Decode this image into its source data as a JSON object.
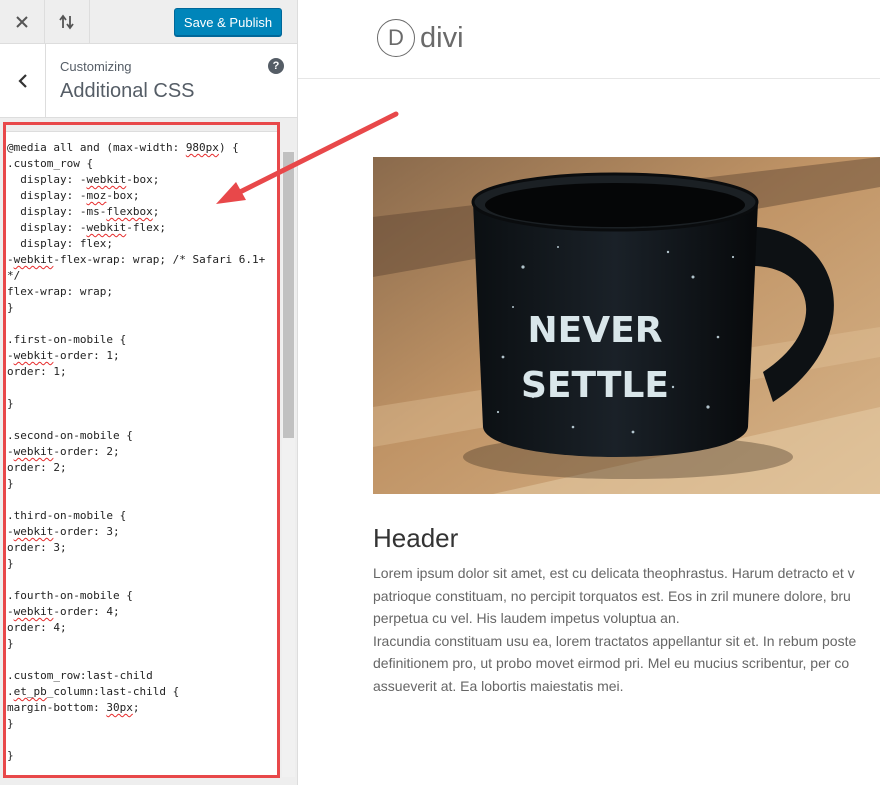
{
  "topbar": {
    "close_icon": "close-x-icon",
    "preview_toggle_icon": "up-down-arrows-icon",
    "publish_label": "Save & Publish"
  },
  "section": {
    "back_icon": "chevron-left-icon",
    "customizing_label": "Customizing",
    "title": "Additional CSS",
    "help_icon_glyph": "?"
  },
  "css_editor": {
    "lines": [
      "@media all and (max-width: 980px) {",
      ".custom_row {",
      "  display: -webkit-box;",
      "  display: -moz-box;",
      "  display: -ms-flexbox;",
      "  display: -webkit-flex;",
      "  display: flex;",
      "-webkit-flex-wrap: wrap; /* Safari 6.1+",
      "*/",
      "flex-wrap: wrap;",
      "}",
      "",
      ".first-on-mobile {",
      "-webkit-order: 1;",
      "order: 1;",
      "",
      "}",
      "",
      ".second-on-mobile {",
      "-webkit-order: 2;",
      "order: 2;",
      "}",
      "",
      ".third-on-mobile {",
      "-webkit-order: 3;",
      "order: 3;",
      "}",
      "",
      ".fourth-on-mobile {",
      "-webkit-order: 4;",
      "order: 4;",
      "}",
      "",
      ".custom_row:last-child",
      ".et_pb_column:last-child {",
      "margin-bottom: 30px;",
      "}",
      "",
      "}"
    ],
    "squiggle_words": [
      "980px",
      "webkit",
      "moz",
      "flexbox",
      "et_pb",
      "30px"
    ]
  },
  "annotation": {
    "highlight_color": "#e8484a"
  },
  "preview": {
    "logo_letter": "D",
    "logo_text": "divi",
    "mug_text_line1": "NEVER",
    "mug_text_line2": "SETTLE",
    "post_title": "Header",
    "body_lines": [
      "Lorem ipsum dolor sit amet, est cu delicata theophrastus. Harum detracto et v",
      "patrioque constituam, no percipit torquatos est. Eos in zril munere dolore, bru",
      "perpetua cu vel. His laudem impetus voluptua an.",
      "Iracundia constituam usu ea, lorem tractatos appellantur sit et. In rebum poste",
      "definitionem pro, ut probo movet eirmod pri. Mel eu mucius scribentur, per co",
      "assueverit at. Ea lobortis maiestatis mei."
    ]
  },
  "colors": {
    "publish_blue": "#0085ba",
    "sidebar_bg": "#eeeeee",
    "annotation_red": "#e8484a"
  }
}
